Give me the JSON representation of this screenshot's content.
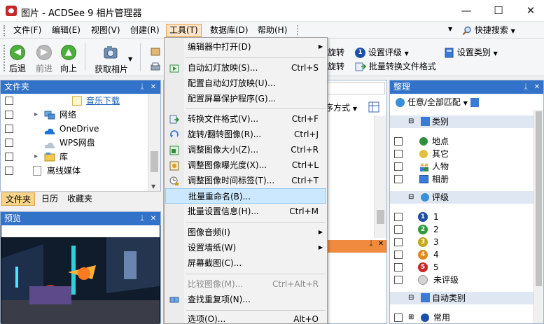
{
  "window": {
    "title": "图片 - ACDSee 9 相片管理器",
    "minimize": "—",
    "maximize": "☐",
    "close": "✕"
  },
  "menubar": {
    "items": [
      "文件(F)",
      "编辑(E)",
      "视图(V)",
      "创建(R)",
      "工具(T)",
      "数据库(D)",
      "帮助(H)"
    ],
    "active_index": 4,
    "quick_search": "快捷搜索"
  },
  "toolbar": {
    "back": "后退",
    "forward": "前进",
    "up": "向上",
    "acquire": "获取相片",
    "rotate_1": "旋转",
    "rotate_2": "旋转",
    "set_rating": "设置评级",
    "batch_convert": "批量转换文件格式",
    "set_category": "设置类别"
  },
  "folder_panel": {
    "title": "文件夹",
    "items": [
      "音乐下载",
      "网络",
      "OneDrive",
      "WPS网盘",
      "库",
      "离线媒体"
    ],
    "tabs": [
      "文件夹",
      "日历",
      "收藏夹"
    ],
    "active_tab": 0
  },
  "preview_panel": {
    "title": "预览"
  },
  "middle": {
    "sort_label": "序方式"
  },
  "organize": {
    "title": "整理",
    "filter": "任意/全部匹配",
    "category_header": "类别",
    "categories": [
      "地点",
      "其它",
      "人物",
      "相册"
    ],
    "rating_header": "评级",
    "ratings": [
      "1",
      "2",
      "3",
      "4",
      "5"
    ],
    "unrated": "未评级",
    "auto_header": "自动类别",
    "auto_first": "常用"
  },
  "tools_menu": {
    "items": [
      {
        "label": "编辑器中打开(D)",
        "shortcut": "",
        "submenu": true
      },
      {
        "label": "自动幻灯放映(S)...",
        "shortcut": "Ctrl+S"
      },
      {
        "label": "配置自动幻灯放映(U)...",
        "shortcut": ""
      },
      {
        "label": "配置屏幕保护程序(G)...",
        "shortcut": ""
      },
      {
        "label": "转换文件格式(V)...",
        "shortcut": "Ctrl+F"
      },
      {
        "label": "旋转/翻转图像(R)...",
        "shortcut": "Ctrl+J"
      },
      {
        "label": "调整图像大小(Z)...",
        "shortcut": "Ctrl+R"
      },
      {
        "label": "调整图像曝光度(X)...",
        "shortcut": "Ctrl+L"
      },
      {
        "label": "调整图像时间标签(T)...",
        "shortcut": "Ctrl+T"
      },
      {
        "label": "批量重命名(B)...",
        "shortcut": ""
      },
      {
        "label": "批量设置信息(H)...",
        "shortcut": "Ctrl+M"
      },
      {
        "label": "图像音频(I)",
        "shortcut": "",
        "submenu": true
      },
      {
        "label": "设置墙纸(W)",
        "shortcut": "",
        "submenu": true
      },
      {
        "label": "屏幕截图(C)...",
        "shortcut": ""
      },
      {
        "label": "比较图像(M)...",
        "shortcut": "Ctrl+Alt+R",
        "disabled": true
      },
      {
        "label": "查找重复项(N)...",
        "shortcut": ""
      },
      {
        "label": "选项(O)...",
        "shortcut": "Alt+O"
      }
    ],
    "hover_index": 9
  },
  "colors": {
    "panel_header": "#3272c8",
    "menu_active": "#fde5c9",
    "menu_hover": "#cce8ff"
  }
}
